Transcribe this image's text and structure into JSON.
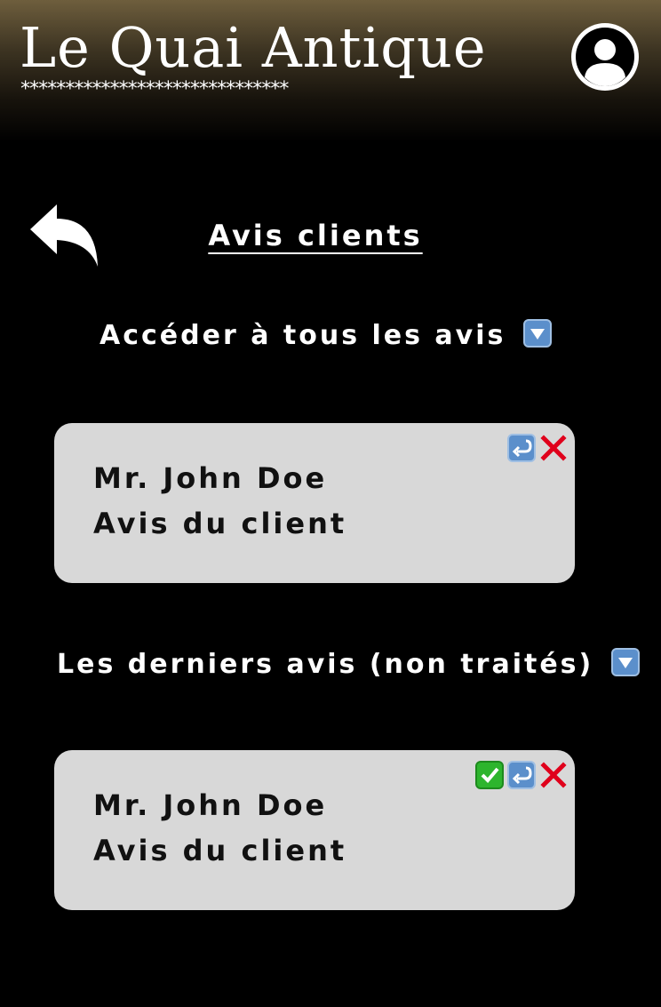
{
  "header": {
    "brand": "Le Quai Antique",
    "decoration": "******************************"
  },
  "page": {
    "title": "Avis clients"
  },
  "sections": [
    {
      "heading": "Accéder à tous les avis",
      "cards": [
        {
          "name": "Mr. John Doe",
          "review": "Avis du client",
          "actions": [
            "reply",
            "delete"
          ]
        }
      ]
    },
    {
      "heading": "Les derniers avis (non traités)",
      "cards": [
        {
          "name": "Mr. John Doe",
          "review": "Avis du client",
          "actions": [
            "validate",
            "reply",
            "delete"
          ]
        }
      ]
    }
  ],
  "icons": {
    "avatar": "user-avatar-icon",
    "back": "back-arrow-icon",
    "expand": "triangle-down-icon",
    "validate": "check-icon",
    "reply": "reply-icon",
    "delete": "cross-icon"
  },
  "colors": {
    "background": "#000000",
    "header_top": "#6e5e3d",
    "card": "#d8d8d8",
    "delete": "#e0001b",
    "validate": "#2db52d",
    "reply": "#4f86c6"
  }
}
